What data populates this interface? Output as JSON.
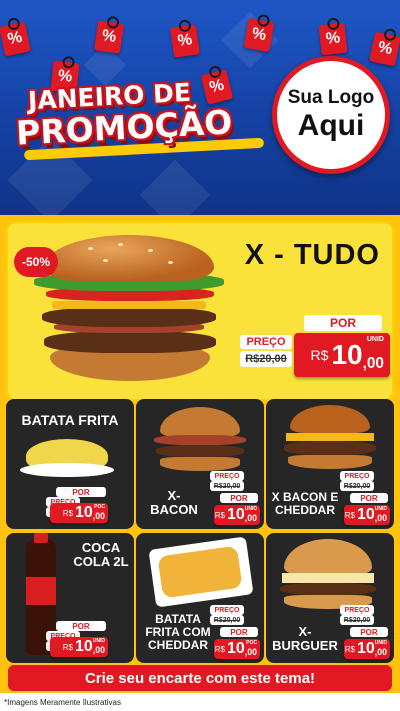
{
  "header": {
    "headline_line1": "JANEIRO DE",
    "headline_line2": "PROMOÇÃO",
    "percent_symbol": "%",
    "logo_line1": "Sua Logo",
    "logo_line2": "Aqui"
  },
  "featured": {
    "discount_badge": "-50%",
    "name": "X - TUDO",
    "preco_label": "PREÇO",
    "old_price": "R$20,00",
    "por_label": "POR",
    "currency": "R$",
    "price_int": "10",
    "price_cents": ",00",
    "unit": "UNID"
  },
  "products": [
    {
      "name": "BATATA FRITA",
      "preco_label": "PREÇO",
      "old_price": "R$20,00",
      "por_label": "POR",
      "currency": "R$",
      "price_int": "10",
      "price_cents": ",00",
      "unit": "POC"
    },
    {
      "name": "X-BACON",
      "preco_label": "PREÇO",
      "old_price": "R$20,00",
      "por_label": "POR",
      "currency": "R$",
      "price_int": "10",
      "price_cents": ",00",
      "unit": "UNID"
    },
    {
      "name": "X BACON E CHEDDAR",
      "preco_label": "PREÇO",
      "old_price": "R$20,00",
      "por_label": "POR",
      "currency": "R$",
      "price_int": "10",
      "price_cents": ",00",
      "unit": "UNID"
    },
    {
      "name": "COCA COLA 2L",
      "preco_label": "PREÇO",
      "old_price": "R$20,00",
      "por_label": "POR",
      "currency": "R$",
      "price_int": "10",
      "price_cents": ",00",
      "unit": "UNID"
    },
    {
      "name": "BATATA FRITA COM CHEDDAR",
      "preco_label": "PREÇO",
      "old_price": "R$20,00",
      "por_label": "POR",
      "currency": "R$",
      "price_int": "10",
      "price_cents": ",00",
      "unit": "POC"
    },
    {
      "name": "X-BURGUER",
      "preco_label": "PREÇO",
      "old_price": "R$20,00",
      "por_label": "POR",
      "currency": "R$",
      "price_int": "10",
      "price_cents": ",00",
      "unit": "UNID"
    }
  ],
  "footer": {
    "cta": "Crie seu encarte com este tema!",
    "disclaimer": "*Imagens Meramente Ilustrativas"
  },
  "colors": {
    "brand_red": "#e01922",
    "header_blue": "#1f57c7",
    "panel_yellow": "#ffc20e",
    "card_dark": "#262626"
  }
}
